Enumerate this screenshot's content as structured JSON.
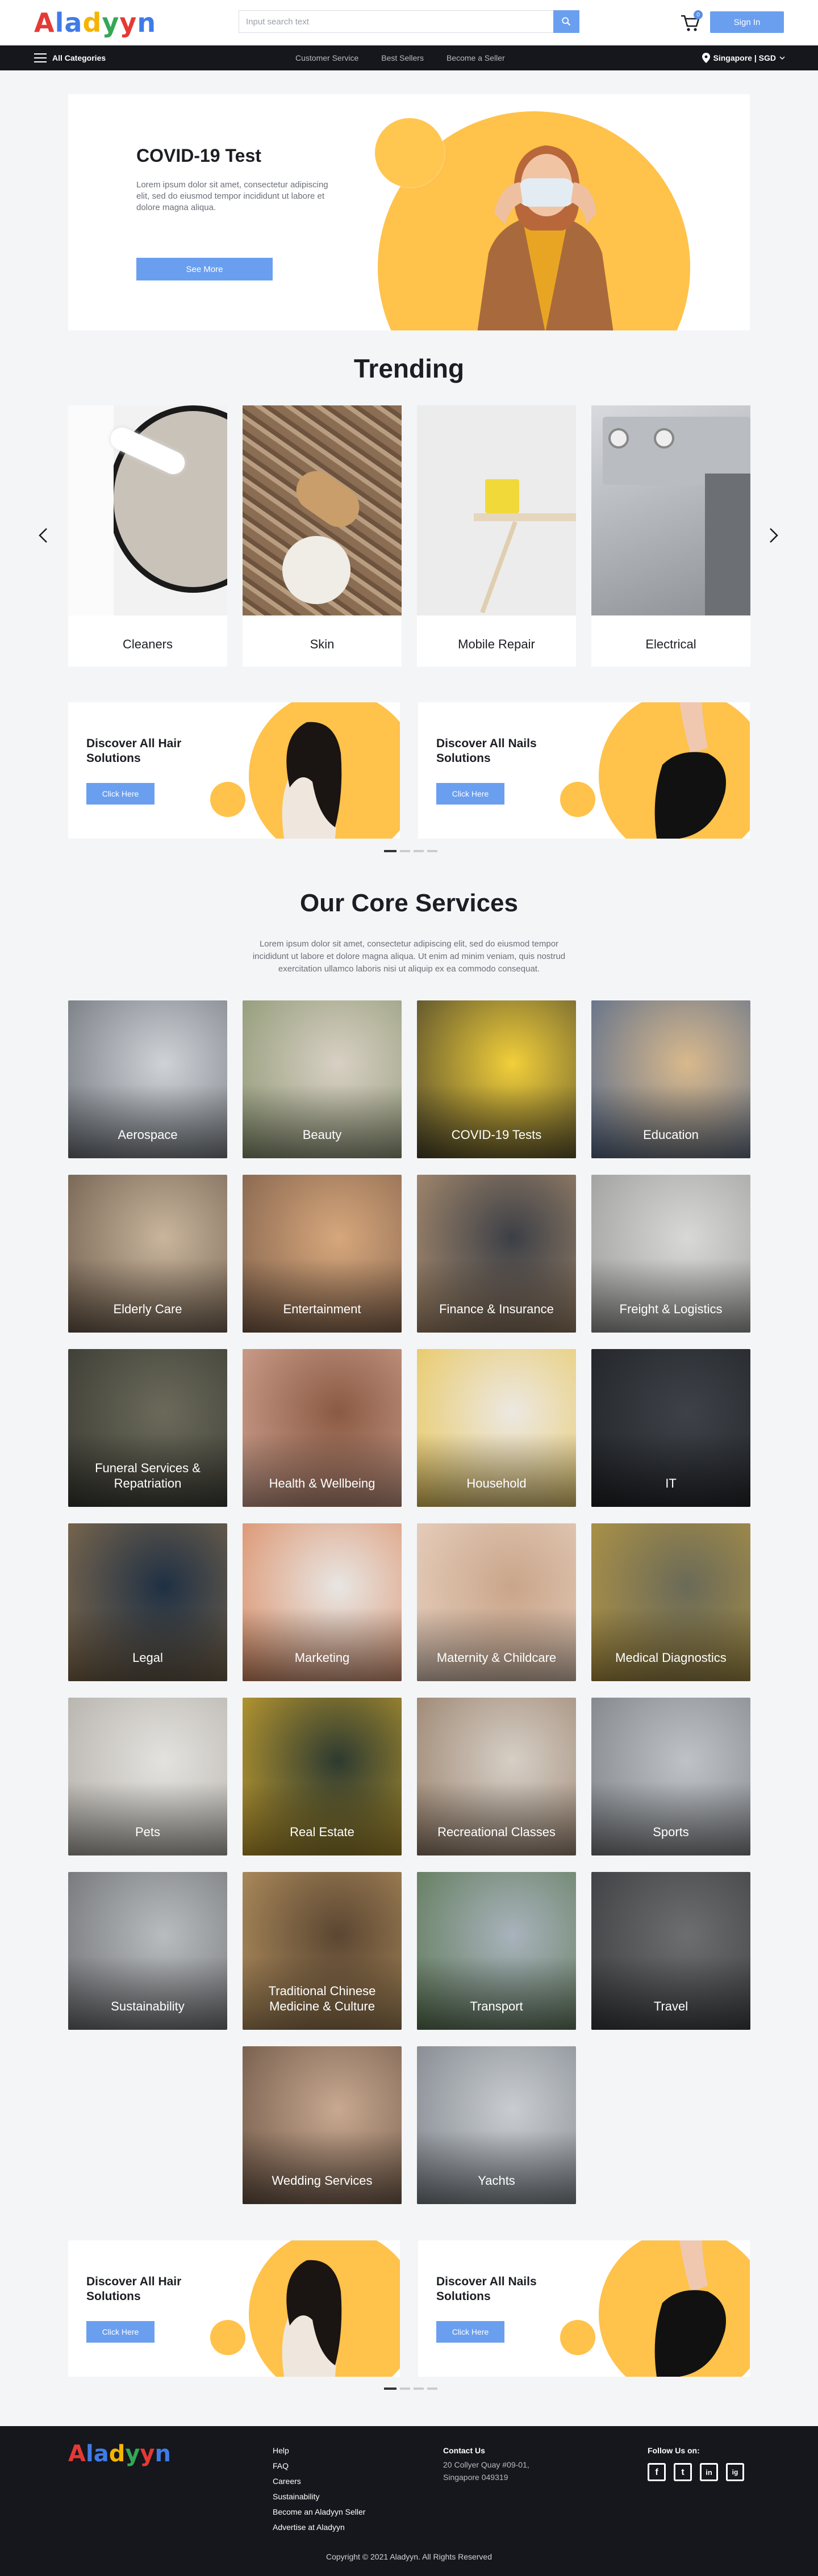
{
  "header": {
    "logo": [
      "A",
      "l",
      "a",
      "d",
      "y",
      "y",
      "n"
    ],
    "logo_colors": [
      "#e53935",
      "#3f7be8",
      "#3f7be8",
      "#f4b400",
      "#34a853",
      "#e53935",
      "#3f7be8"
    ],
    "search_placeholder": "Input search text",
    "cart_count": "0",
    "signin_label": "Sign In"
  },
  "nav": {
    "categories_label": "All Categories",
    "links": [
      "Customer Service",
      "Best Sellers",
      "Become a Seller"
    ],
    "region": "Singapore | SGD"
  },
  "hero": {
    "title": "COVID-19 Test",
    "body": "Lorem ipsum dolor sit amet, consectetur adipiscing elit, sed do eiusmod tempor incididunt ut labore et dolore magna aliqua.",
    "button": "See More"
  },
  "trending": {
    "title": "Trending",
    "items": [
      "Cleaners",
      "Skin",
      "Mobile Repair",
      "Electrical"
    ]
  },
  "promos": [
    {
      "title": "Discover All Hair Solutions",
      "button": "Click Here"
    },
    {
      "title": "Discover All Nails Solutions",
      "button": "Click Here"
    }
  ],
  "core": {
    "title": "Our Core Services",
    "description": "Lorem ipsum dolor sit amet, consectetur adipiscing elit, sed do eiusmod tempor incididunt ut labore et dolore magna aliqua. Ut enim ad minim veniam, quis nostrud exercitation ullamco laboris nisi ut aliquip ex ea commodo consequat.",
    "services": [
      "Aerospace",
      "Beauty",
      "COVID-19 Tests",
      "Education",
      "Elderly Care",
      "Entertainment",
      "Finance & Insurance",
      "Freight & Logistics",
      "Funeral Services & Repatriation",
      "Health & Wellbeing",
      "Household",
      "IT",
      "Legal",
      "Marketing",
      "Maternity & Childcare",
      "Medical Diagnostics",
      "Pets",
      "Real Estate",
      "Recreational Classes",
      "Sports",
      "Sustainability",
      "Traditional Chinese Medicine & Culture",
      "Transport",
      "Travel",
      "Wedding Services",
      "Yachts"
    ]
  },
  "footer": {
    "links": [
      "Help",
      "FAQ",
      "Careers",
      "Sustainability",
      "Become an Aladyyn Seller",
      "Advertise at Aladyyn"
    ],
    "contact_title": "Contact Us",
    "contact_address": "20 Collyer Quay #09-01, Singapore 049319",
    "follow_title": "Follow Us on:",
    "social": [
      "f",
      "t",
      "in",
      "ig"
    ],
    "copyright": "Copyright © 2021 Aladyyn. All Rights Reserved"
  }
}
